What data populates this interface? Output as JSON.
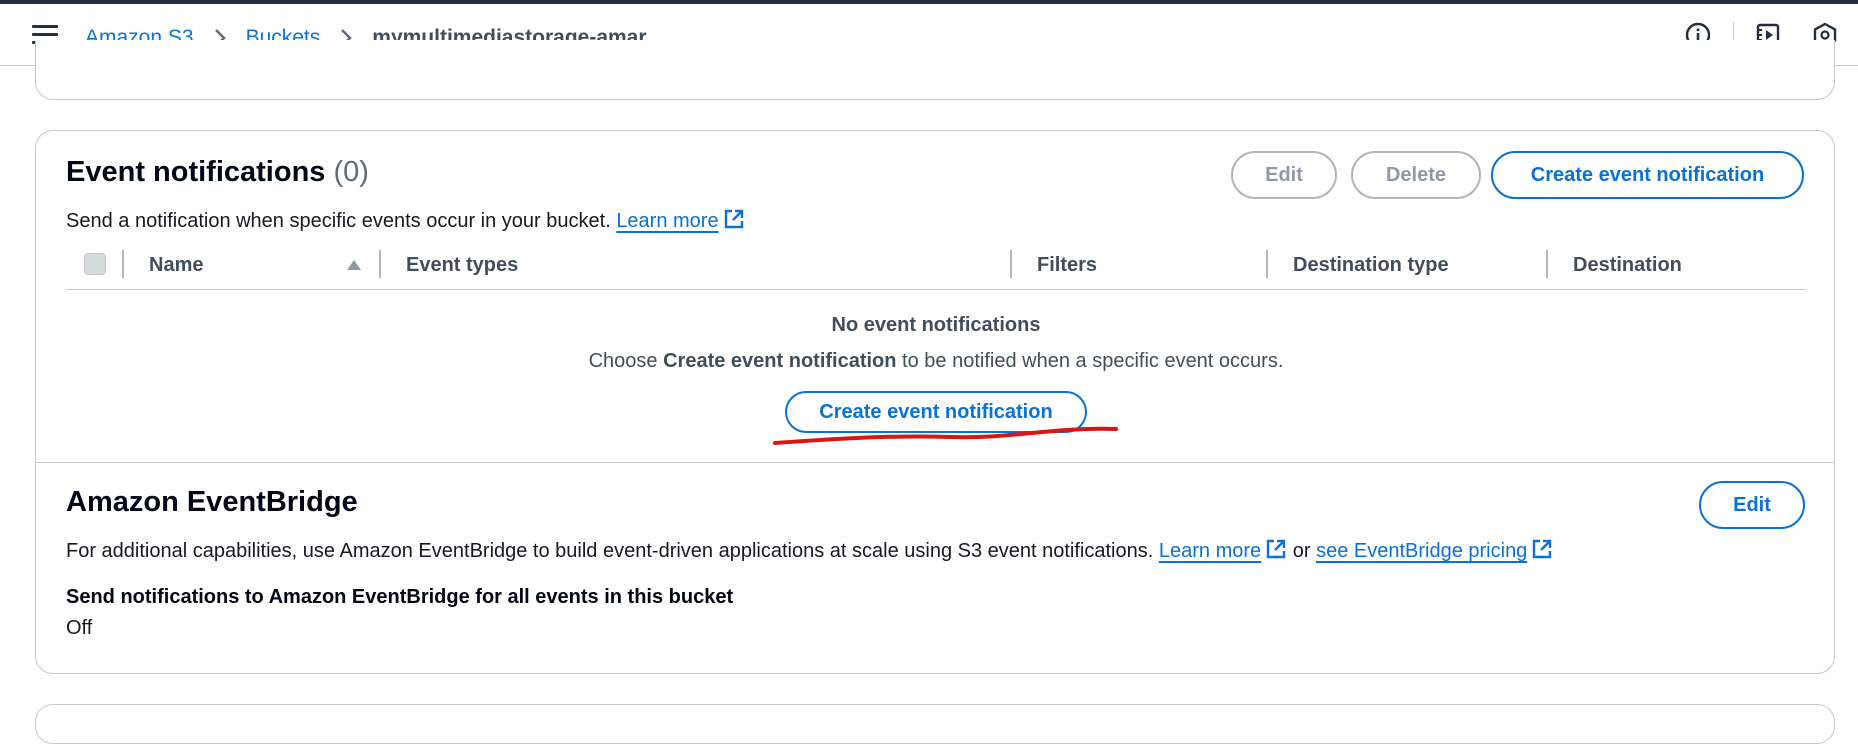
{
  "breadcrumb": {
    "items": [
      "Amazon S3",
      "Buckets"
    ],
    "current": "mymultimediastorage-amar"
  },
  "top_icons": [
    "info-icon",
    "video-panel-icon",
    "settings-hex-icon"
  ],
  "event_notifications": {
    "title": "Event notifications",
    "count": "(0)",
    "description": "Send a notification when specific events occur in your bucket.",
    "learn_more": "Learn more",
    "buttons": {
      "edit": "Edit",
      "delete": "Delete",
      "create": "Create event notification"
    },
    "columns": [
      "Name",
      "Event types",
      "Filters",
      "Destination type",
      "Destination"
    ],
    "empty": {
      "title": "No event notifications",
      "desc_prefix": "Choose ",
      "desc_bold": "Create event notification",
      "desc_suffix": " to be notified when a specific event occurs.",
      "button": "Create event notification"
    }
  },
  "eventbridge": {
    "title": "Amazon EventBridge",
    "edit": "Edit",
    "description": "For additional capabilities, use Amazon EventBridge to build event-driven applications at scale using S3 event notifications.",
    "learn_more": "Learn more",
    "or": "or",
    "pricing_link": "see EventBridge pricing",
    "field_label": "Send notifications to Amazon EventBridge for all events in this bucket",
    "field_value": "Off"
  },
  "colors": {
    "link": "#0972d3",
    "annotation": "#d91515",
    "border": "#c6c6cd"
  }
}
